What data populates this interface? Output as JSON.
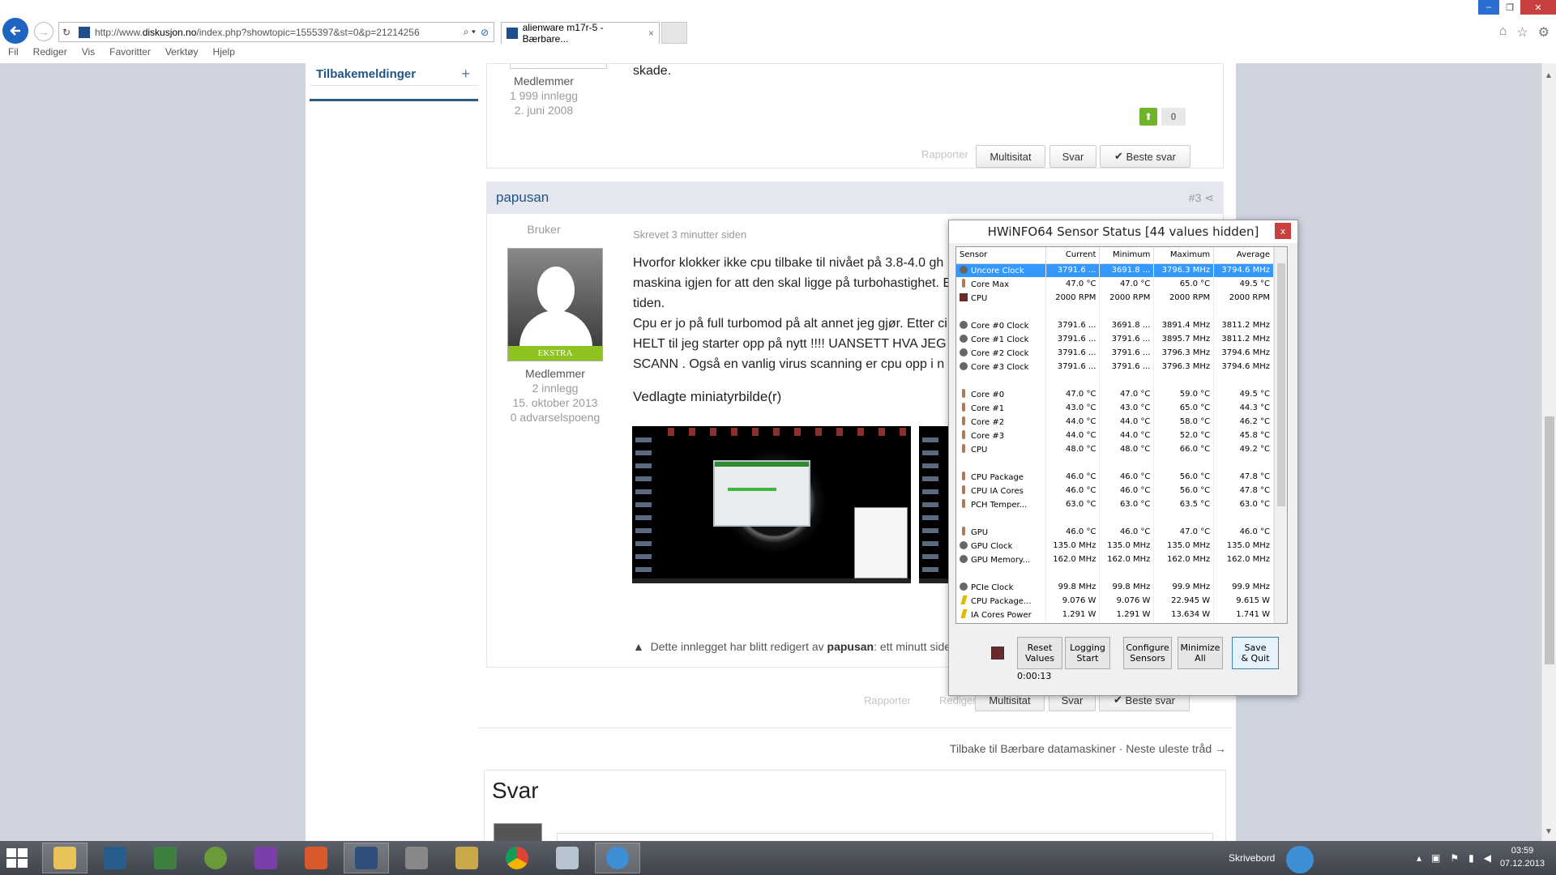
{
  "browser": {
    "url_prefix": "http://www.",
    "url_domain": "diskusjon.no",
    "url_rest": "/index.php?showtopic=1555397&st=0&p=21214256",
    "tab_title": "alienware m17r-5 - Bærbare...",
    "menu": [
      "Fil",
      "Rediger",
      "Vis",
      "Favoritter",
      "Verktøy",
      "Hjelp"
    ]
  },
  "sidebar": {
    "title": "Tilbakemeldinger",
    "plus": "+"
  },
  "post2": {
    "role": "Medlemmer",
    "posts": "1 999 innlegg",
    "joined": "2. juni 2008",
    "text": "skade.",
    "vote_count": "0",
    "report": "Rapporter",
    "multiquote": "Multisitat",
    "reply": "Svar",
    "best": "Beste svar"
  },
  "post3": {
    "author": "papusan",
    "number": "#3",
    "rank": "Bruker",
    "badge": "EKSTRA",
    "role": "Medlemmer",
    "posts": "2 innlegg",
    "joined": "15. oktober 2013",
    "warnings": "0 advarselspoeng",
    "written": "Skrevet 3 minutter siden",
    "lines": [
      "Hvorfor klokker ikke cpu  tilbake til nivået på 3.8-4.0 gh",
      "maskina igjen for att den skal ligge på turbohastighet. E",
      "tiden.",
      "Cpu er jo på full turbomod på alt annet jeg gjør. Etter ci",
      "HELT til jeg starter opp på nytt !!!! UANSETT HVA JEG",
      "SCANN . Også en vanlig virus scanning  er cpu opp i n"
    ],
    "attachments_title": "Vedlagte miniatyrbilde(r)",
    "edited_prefix": "Dette innlegget har blitt redigert av ",
    "edited_by": "papusan",
    "edited_suffix": ": ett minutt side",
    "report": "Rapporter",
    "edit": "Rediger",
    "multiquote": "Multisitat",
    "reply": "Svar",
    "best": "Beste svar"
  },
  "nav": {
    "back": "Tilbake til Bærbare datamaskiner",
    "sep": "·",
    "next": "Neste uleste tråd →"
  },
  "reply_heading": "Svar",
  "hwinfo": {
    "title": "HWiNFO64 Sensor Status [44 values hidden]",
    "close": "x",
    "columns": [
      "Sensor",
      "Current",
      "Minimum",
      "Maximum",
      "Average"
    ],
    "rows": [
      {
        "icon": "clock",
        "name": "Uncore Clock",
        "cur": "3791.6 ...",
        "min": "3691.8 ...",
        "max": "3796.3 MHz",
        "avg": "3794.6 MHz",
        "selected": true
      },
      {
        "icon": "temp",
        "name": "Core Max",
        "cur": "47.0 °C",
        "min": "47.0 °C",
        "max": "65.0 °C",
        "avg": "49.5 °C"
      },
      {
        "icon": "fan",
        "name": "CPU",
        "cur": "2000 RPM",
        "min": "2000 RPM",
        "max": "2000 RPM",
        "avg": "2000 RPM"
      },
      {
        "icon": "",
        "name": "",
        "cur": "",
        "min": "",
        "max": "",
        "avg": ""
      },
      {
        "icon": "clock",
        "name": "Core #0 Clock",
        "cur": "3791.6 ...",
        "min": "3691.8 ...",
        "max": "3891.4 MHz",
        "avg": "3811.2 MHz"
      },
      {
        "icon": "clock",
        "name": "Core #1 Clock",
        "cur": "3791.6 ...",
        "min": "3791.6 ...",
        "max": "3895.7 MHz",
        "avg": "3811.2 MHz"
      },
      {
        "icon": "clock",
        "name": "Core #2 Clock",
        "cur": "3791.6 ...",
        "min": "3791.6 ...",
        "max": "3796.3 MHz",
        "avg": "3794.6 MHz"
      },
      {
        "icon": "clock",
        "name": "Core #3 Clock",
        "cur": "3791.6 ...",
        "min": "3791.6 ...",
        "max": "3796.3 MHz",
        "avg": "3794.6 MHz"
      },
      {
        "icon": "",
        "name": "",
        "cur": "",
        "min": "",
        "max": "",
        "avg": ""
      },
      {
        "icon": "temp",
        "name": "Core #0",
        "cur": "47.0 °C",
        "min": "47.0 °C",
        "max": "59.0 °C",
        "avg": "49.5 °C"
      },
      {
        "icon": "temp",
        "name": "Core #1",
        "cur": "43.0 °C",
        "min": "43.0 °C",
        "max": "65.0 °C",
        "avg": "44.3 °C"
      },
      {
        "icon": "temp",
        "name": "Core #2",
        "cur": "44.0 °C",
        "min": "44.0 °C",
        "max": "58.0 °C",
        "avg": "46.2 °C"
      },
      {
        "icon": "temp",
        "name": "Core #3",
        "cur": "44.0 °C",
        "min": "44.0 °C",
        "max": "52.0 °C",
        "avg": "45.8 °C"
      },
      {
        "icon": "temp",
        "name": "CPU",
        "cur": "48.0 °C",
        "min": "48.0 °C",
        "max": "66.0 °C",
        "avg": "49.2 °C"
      },
      {
        "icon": "",
        "name": "",
        "cur": "",
        "min": "",
        "max": "",
        "avg": ""
      },
      {
        "icon": "temp",
        "name": "CPU Package",
        "cur": "46.0 °C",
        "min": "46.0 °C",
        "max": "56.0 °C",
        "avg": "47.8 °C"
      },
      {
        "icon": "temp",
        "name": "CPU IA Cores",
        "cur": "46.0 °C",
        "min": "46.0 °C",
        "max": "56.0 °C",
        "avg": "47.8 °C"
      },
      {
        "icon": "temp",
        "name": "PCH Temper...",
        "cur": "63.0 °C",
        "min": "63.0 °C",
        "max": "63.5 °C",
        "avg": "63.0 °C"
      },
      {
        "icon": "",
        "name": "",
        "cur": "",
        "min": "",
        "max": "",
        "avg": ""
      },
      {
        "icon": "temp",
        "name": "GPU",
        "cur": "46.0 °C",
        "min": "46.0 °C",
        "max": "47.0 °C",
        "avg": "46.0 °C"
      },
      {
        "icon": "clock",
        "name": "GPU Clock",
        "cur": "135.0 MHz",
        "min": "135.0 MHz",
        "max": "135.0 MHz",
        "avg": "135.0 MHz"
      },
      {
        "icon": "clock",
        "name": "GPU Memory...",
        "cur": "162.0 MHz",
        "min": "162.0 MHz",
        "max": "162.0 MHz",
        "avg": "162.0 MHz"
      },
      {
        "icon": "",
        "name": "",
        "cur": "",
        "min": "",
        "max": "",
        "avg": ""
      },
      {
        "icon": "clock",
        "name": "PCIe Clock",
        "cur": "99.8 MHz",
        "min": "99.8 MHz",
        "max": "99.9 MHz",
        "avg": "99.9 MHz"
      },
      {
        "icon": "power",
        "name": "CPU Package...",
        "cur": "9.076 W",
        "min": "9.076 W",
        "max": "22.945 W",
        "avg": "9.615 W"
      },
      {
        "icon": "power",
        "name": "IA Cores Power",
        "cur": "1.291 W",
        "min": "1.291 W",
        "max": "13.634 W",
        "avg": "1.741 W"
      }
    ],
    "buttons": {
      "reset": [
        "Reset",
        "Values"
      ],
      "logging": [
        "Logging",
        "Start"
      ],
      "configure": [
        "Configure",
        "Sensors"
      ],
      "minimize": [
        "Minimize",
        "All"
      ],
      "save": [
        "Save",
        "& Quit"
      ]
    },
    "timer": "0:00:13"
  },
  "taskbar": {
    "desktop_label": "Skrivebord",
    "time": "03:59",
    "date": "07.12.2013"
  }
}
